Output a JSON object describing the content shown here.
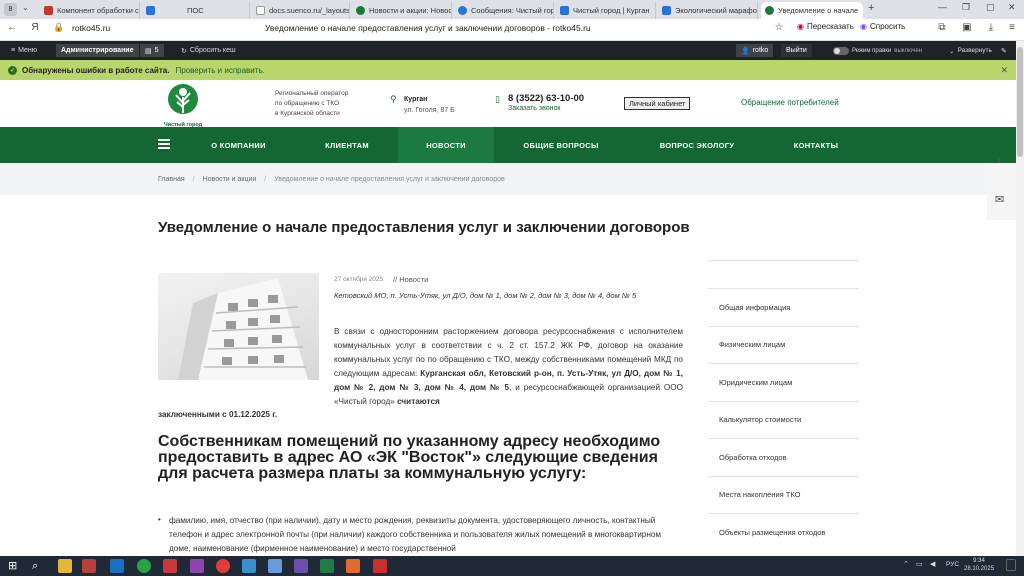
{
  "browser": {
    "tab_count": "8",
    "tabs": [
      {
        "title": "Компонент обработки с",
        "color": "#c0392b"
      },
      {
        "title": "ПОС",
        "color": "#2a73d9"
      },
      {
        "title": "docs.suenco.ru/_layouts/",
        "color": "#ffffff"
      },
      {
        "title": "Новости и акции: Новос",
        "color": "#1b7a3b"
      },
      {
        "title": "Сообщения: Чистый гор",
        "color": "#2a73d9"
      },
      {
        "title": "Чистый город | Курган",
        "color": "#2a73d9"
      },
      {
        "title": "Экологический марафо",
        "color": "#2a73d9"
      },
      {
        "title": "Уведомление о начале",
        "color": "#1b7a3b"
      }
    ],
    "url": "rotko45.ru",
    "page_title": "Уведомление о начале предоставления услуг и заключении договоров - rotko45.ru",
    "retell_label": "Пересказать",
    "ask_label": "Спросить"
  },
  "admin_bar": {
    "menu": "Меню",
    "admin": "Администрирование",
    "count": "5",
    "reset_cache": "Сбросить кеш",
    "user": "rotko",
    "logout": "Выйти",
    "edit_mode_label": "Режим правки",
    "edit_mode_state": "выключен",
    "expand": "Развернуть"
  },
  "error_bar": {
    "text": "Обнаружены ошибки в работе сайта.",
    "link": "Проверить и исправить."
  },
  "header": {
    "logo_text": "Чистый город",
    "operator_line1": "Региональный оператор",
    "operator_line2": "по обращению с ТКО",
    "operator_line3": "в Курганской области",
    "city": "Курган",
    "address": "ул. Гоголя, 87 Б",
    "phone": "8 (3522) 63-10-00",
    "callback": "Заказать звонок",
    "cabinet": "Личный кабинет",
    "appeal": "Обращение потребителей"
  },
  "nav": [
    "О КОМПАНИИ",
    "КЛИЕНТАМ",
    "НОВОСТИ",
    "ОБЩИЕ ВОПРОСЫ",
    "ВОПРОС ЭКОЛОГУ",
    "КОНТАКТЫ"
  ],
  "breadcrumbs": [
    "Главная",
    "Новости и акции",
    "Уведомление о начале предоставления услуг и заключении договоров"
  ],
  "article": {
    "title": "Уведомление о начале предоставления услуг и заключении договоров",
    "date": "27 октября 2025",
    "category": "// Новости",
    "location": "Кетовский МО, п. Усть-Утяк, ул Д/О, дом № 1, дом № 2, дом № 3, дом № 4, дом № 5",
    "para_a": "В связи с односторонним расторжением договора ресурсоснабжения с исполнителем коммунальных услуг в соответствии с ч. 2 ст. 157.2 ЖК РФ, договор на оказание коммунальных услуг по по обращению с ТКО, между собственниками помещений МКД по следующим адресам: ",
    "para_b": "Курганская обл, Кетовский р-он, п. Усть-Утяк, ул Д/О, дом № 1, дом № 2, дом № 3, дом № 4, дом № 5",
    "para_c": ", и ресурсоснабжающей организацией ООО «Чистый город» ",
    "para_d": "считаются",
    "para_e": "заключенными с 01.12.2025 г.",
    "subheading": "Собственникам помещений по указанному адресу необходимо предоставить в адрес АО «ЭК \"Восток\"» следующие сведения для расчета размера платы за коммунальную услугу:",
    "bullet1": "фамилию, имя, отчество (при наличии), дату и место рождения, реквизиты документа, удостоверяющего личность, контактный телефон и адрес электронной почты (при наличии) каждого собственника и пользователя жилых помещений в многоквартирном доме, наименование (фирменное наименование) и место государственной"
  },
  "sidebar": [
    "Общая информация",
    "Физическим лицам",
    "Юридическим лицам",
    "Калькулятор стоимости",
    "Обработка отходов",
    "Места накопления ТКО",
    "Объекты размещения отходов"
  ],
  "taskbar": {
    "lang": "РУС",
    "time": "9:34",
    "date": "28.10.2025"
  },
  "colors": {
    "brand_green": "#146633",
    "admin_bg": "#1d2327",
    "error_bg": "#b9d66c"
  }
}
